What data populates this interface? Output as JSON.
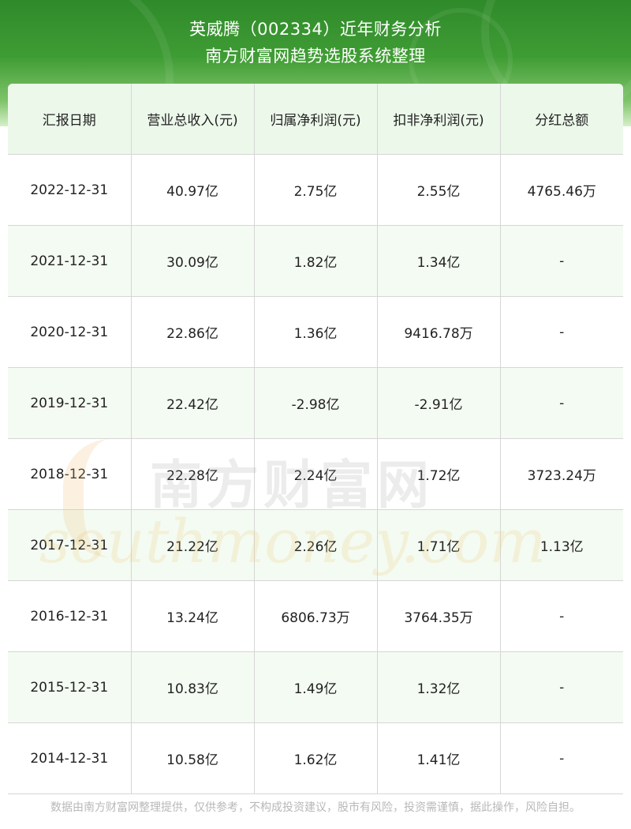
{
  "header": {
    "title_line1": "英威腾（002334）近年财务分析",
    "title_line2": "南方财富网趋势选股系统整理"
  },
  "table": {
    "columns": [
      "汇报日期",
      "营业总收入(元)",
      "归属净利润(元)",
      "扣非净利润(元)",
      "分红总额"
    ],
    "rows": [
      [
        "2022-12-31",
        "40.97亿",
        "2.75亿",
        "2.55亿",
        "4765.46万"
      ],
      [
        "2021-12-31",
        "30.09亿",
        "1.82亿",
        "1.34亿",
        "-"
      ],
      [
        "2020-12-31",
        "22.86亿",
        "1.36亿",
        "9416.78万",
        "-"
      ],
      [
        "2019-12-31",
        "22.42亿",
        "-2.98亿",
        "-2.91亿",
        "-"
      ],
      [
        "2018-12-31",
        "22.28亿",
        "2.24亿",
        "1.72亿",
        "3723.24万"
      ],
      [
        "2017-12-31",
        "21.22亿",
        "2.26亿",
        "1.71亿",
        "1.13亿"
      ],
      [
        "2016-12-31",
        "13.24亿",
        "6806.73万",
        "3764.35万",
        "-"
      ],
      [
        "2015-12-31",
        "10.83亿",
        "1.49亿",
        "1.32亿",
        "-"
      ],
      [
        "2014-12-31",
        "10.58亿",
        "1.62亿",
        "1.41亿",
        "-"
      ]
    ]
  },
  "watermark": {
    "cn": "南方财富网",
    "en": "southmoney.com"
  },
  "footer": {
    "disclaimer": "数据由南方财富网整理提供，仅供参考，不构成投资建议，股市有风险，投资需谨慎，据此操作，风险自担。"
  },
  "colors": {
    "header_green": "#3f9c34",
    "header_row_bg": "#ecf8ea",
    "alt_row_bg": "#f4fbf2",
    "grid_line": "#d6d6d6",
    "footer_text": "#b8b8b8"
  }
}
